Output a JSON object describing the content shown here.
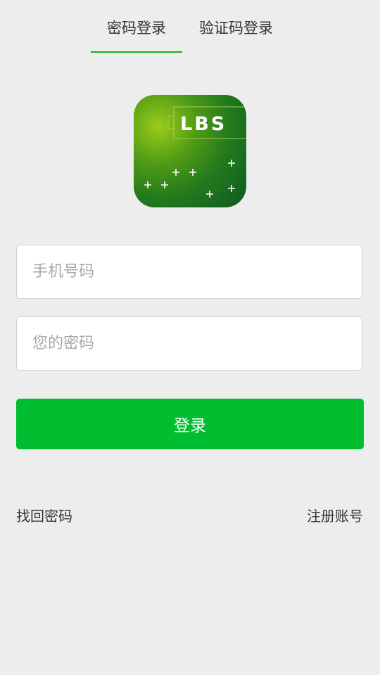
{
  "tabs": {
    "password_login": "密码登录",
    "code_login": "验证码登录",
    "active": "password_login"
  },
  "logo": {
    "text": "LBS",
    "icon": "lbs-app-logo-icon"
  },
  "form": {
    "phone_placeholder": "手机号码",
    "phone_value": "",
    "password_placeholder": "您的密码",
    "password_value": "",
    "login_label": "登录"
  },
  "links": {
    "forgot_password": "找回密码",
    "register": "注册账号"
  },
  "colors": {
    "accent": "#00be2f",
    "tab_indicator": "#1aad19",
    "background": "#ededed"
  }
}
